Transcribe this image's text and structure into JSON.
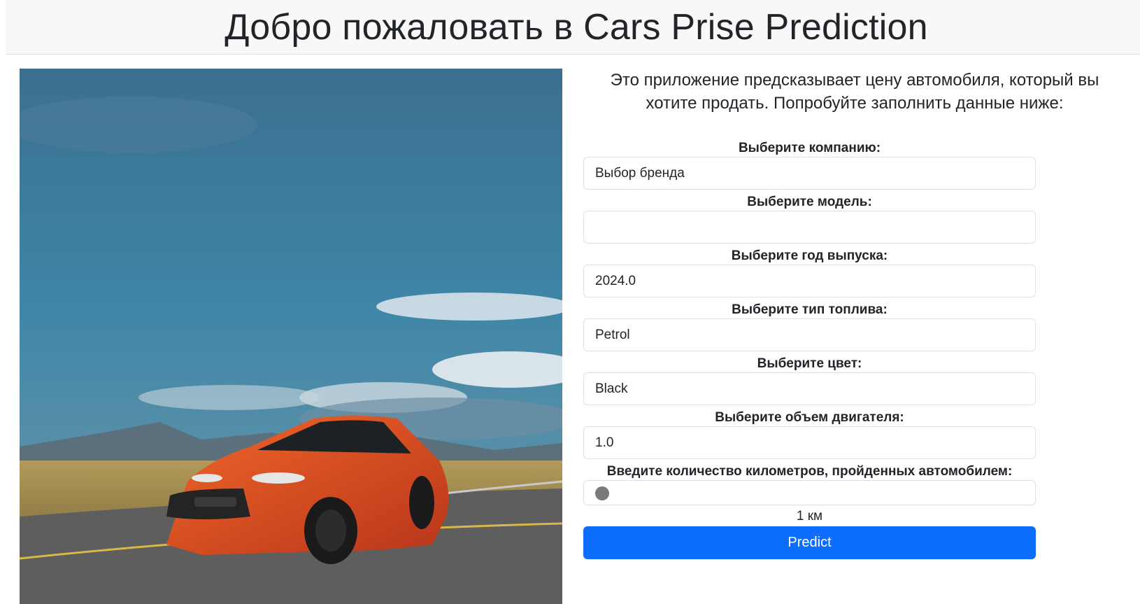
{
  "header": {
    "title": "Добро пожаловать в Cars Prise Prediction"
  },
  "hero": {
    "alt": "orange-sedan-on-road-photo"
  },
  "intro": {
    "text": "Это приложение предсказывает цену автомобиля, который вы хотите продать. Попробуйте заполнить данные ниже:"
  },
  "form": {
    "company": {
      "label": "Выберите компанию:",
      "value": "Выбор бренда"
    },
    "model": {
      "label": "Выберите модель:",
      "value": ""
    },
    "year": {
      "label": "Выберите год выпуска:",
      "value": "2024.0"
    },
    "fuel": {
      "label": "Выберите тип топлива:",
      "value": "Petrol"
    },
    "color": {
      "label": "Выберите цвет:",
      "value": "Black"
    },
    "engine": {
      "label": "Выберите объем двигателя:",
      "value": "1.0"
    },
    "kms": {
      "label": "Введите количество километров, пройденных автомобилем:",
      "value_text": "1 км",
      "level": 0
    },
    "predict_label": "Predict"
  },
  "colors": {
    "accent": "#0d6efd",
    "header_bg": "#f8f8f8"
  }
}
